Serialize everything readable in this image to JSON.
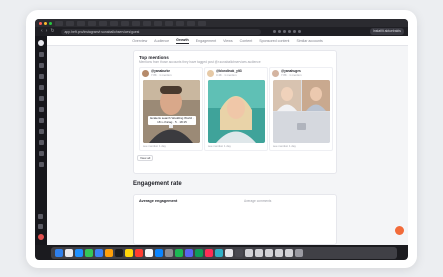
{
  "browser": {
    "url": "app.heft.pro/instagram/r.sunaballohservices/guest",
    "profile_label": "Instafilt aktuelrakts"
  },
  "subnav": {
    "tabs": [
      "Overview",
      "Audience",
      "Growth",
      "Engagement",
      "Views",
      "Content",
      "Sponsored content",
      "Similar accounts"
    ],
    "active": "Growth"
  },
  "top_mentions": {
    "title": "Top mentions",
    "subtitle": "Mentions from those accounts they have tagged post @r.sunaballohservices audience",
    "cards": [
      {
        "name": "@yanaburke",
        "meta": "7.8K · 1 mention",
        "caption": "Ecaleris search Wedding World · 18 x chicag · 5 · 18:15",
        "footer": "see mention 1 day"
      },
      {
        "name": "@blondinok_ylt3",
        "meta": "3.4K · 1 mention",
        "caption": "",
        "footer": "see mention 1 day"
      },
      {
        "name": "@yanahuges",
        "meta": "7.8K · 1 mention",
        "caption": "",
        "footer": "see mention 1 day"
      }
    ],
    "see_all_label": "View all"
  },
  "engagement": {
    "section_title": "Engagement rate",
    "card_label": "Average engagement",
    "secondary_label": "Average comments"
  },
  "colors": {
    "accent": "#f26b3a",
    "sidebar": "#17171c"
  }
}
